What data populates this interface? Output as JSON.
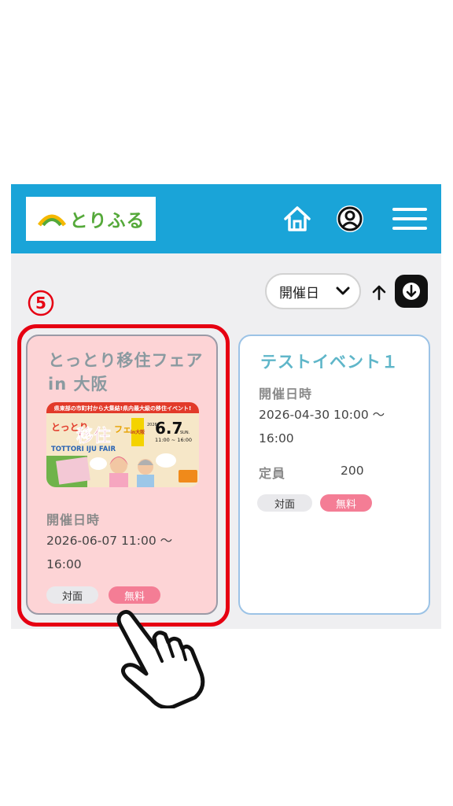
{
  "header": {
    "logo_text": "とりふる",
    "icons": [
      "home-icon",
      "account-icon",
      "menu-icon"
    ]
  },
  "toolbar": {
    "sort_label": "開催日",
    "sort_options": [
      "開催日"
    ]
  },
  "step_marker": "⑤",
  "events": [
    {
      "title": "とっとり移住フェア in 大阪",
      "image": {
        "top_banner": "県東部の市町村から大集結!県内最大級の移住イベント!",
        "main_line1": "とっとり",
        "main_line2": "移住",
        "main_line3": "フェア",
        "city_badge": "in大阪",
        "date": "6.7",
        "day": "SUN.",
        "year": "2026",
        "time": "11:00 ~ 16:00",
        "english": "TOTTORI IJU FAIR"
      },
      "datetime_label": "開催日時",
      "datetime": "2026-06-07 11:00 〜 16:00",
      "tags": [
        "対面",
        "無料"
      ]
    },
    {
      "title": "テストイベント１",
      "datetime_label": "開催日時",
      "datetime": "2026-04-30 10:00 〜 16:00",
      "capacity_label": "定員",
      "capacity": "200",
      "tags": [
        "対面",
        "無料"
      ]
    }
  ],
  "colors": {
    "header_bg": "#1aa4d8",
    "highlight": "#e60012",
    "card_highlight_bg": "#fdd4d6",
    "tag_pink": "#f47d95",
    "logo_green": "#55a93a"
  }
}
